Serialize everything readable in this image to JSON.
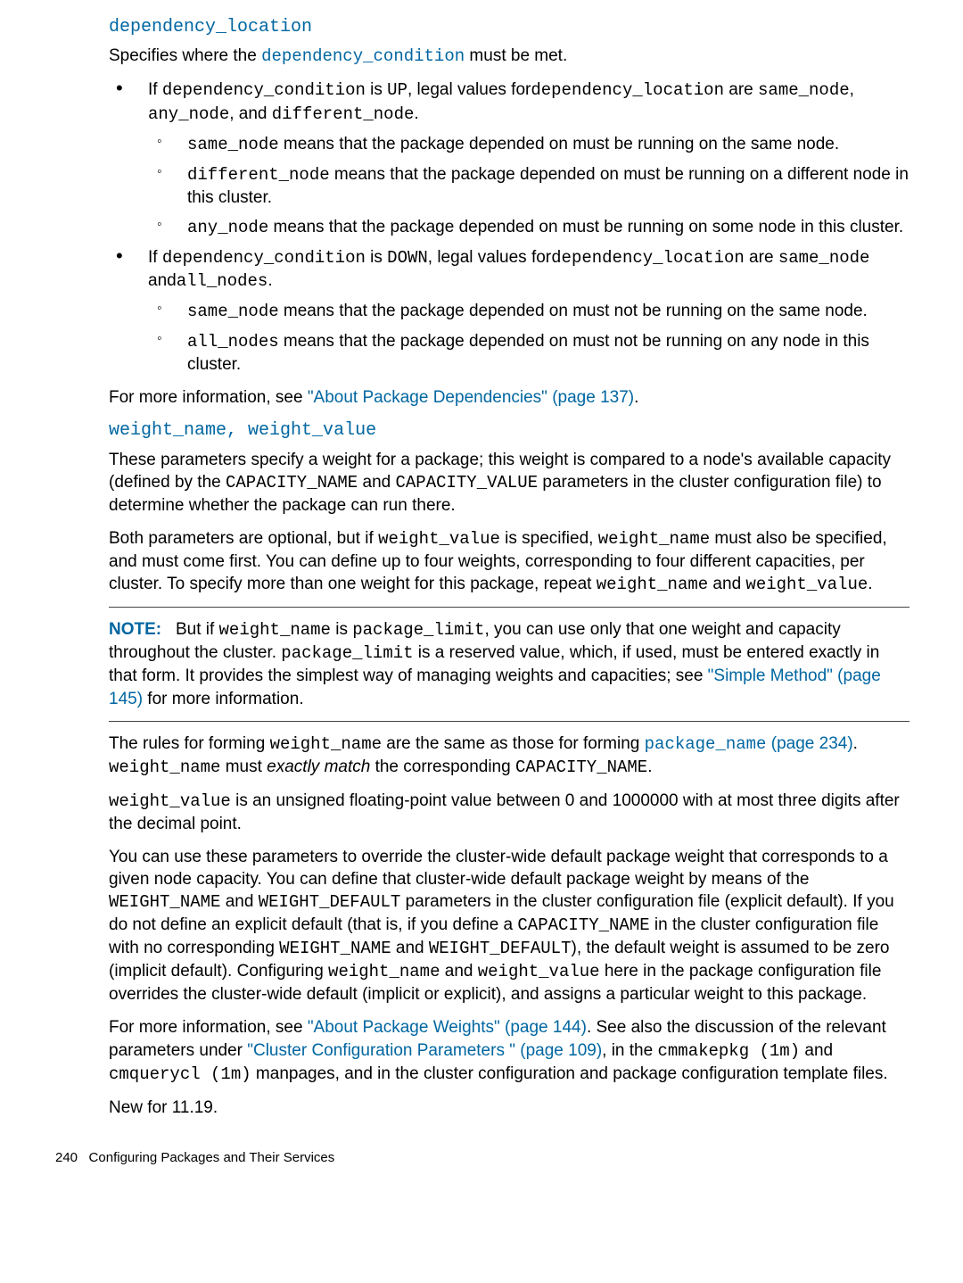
{
  "sec1": {
    "heading": "dependency_location",
    "intro_a": "Specifies where the ",
    "intro_b": "dependency_condition",
    "intro_c": " must be met.",
    "li1_a": "If ",
    "li1_b": "dependency_condition",
    "li1_c": " is ",
    "li1_d": "UP",
    "li1_e": ", legal values for",
    "li1_f": "dependency_location",
    "li1_g": " are ",
    "li1_h": "same_node",
    "li1_i": ", ",
    "li1_j": "any_node",
    "li1_k": ", and ",
    "li1_l": "different_node",
    "li1_m": ".",
    "li1s1_a": "same_node",
    "li1s1_b": " means that the package depended on must be running on the same node.",
    "li1s2_a": "different_node",
    "li1s2_b": " means that the package depended on must be running on a different node in this cluster.",
    "li1s3_a": "any_node",
    "li1s3_b": " means that the package depended on must be running on some node in this cluster.",
    "li2_a": "If ",
    "li2_b": "dependency_condition",
    "li2_c": " is ",
    "li2_d": "DOWN",
    "li2_e": ", legal values for",
    "li2_f": "dependency_location",
    "li2_g": " are ",
    "li2_h": "same_node",
    "li2_i": " and",
    "li2_j": "all_nodes",
    "li2_k": ".",
    "li2s1_a": "same_node",
    "li2s1_b": " means that the package depended on must not be running on the same node.",
    "li2s2_a": "all_nodes",
    "li2s2_b": " means that the package depended on must not be running on any node in this cluster.",
    "more_a": "For more information, see ",
    "more_b": "\"About Package Dependencies\" (page 137)",
    "more_c": "."
  },
  "sec2": {
    "heading_a": "weight_name",
    "heading_sep": ", ",
    "heading_b": "weight_value",
    "p1_a": "These parameters specify a weight for a package; this weight is compared to a node's available capacity (defined by the ",
    "p1_b": "CAPACITY_NAME",
    "p1_c": " and ",
    "p1_d": "CAPACITY_VALUE",
    "p1_e": " parameters in the cluster configuration file) to determine whether the package can run there.",
    "p2_a": "Both parameters are optional, but if ",
    "p2_b": "weight_value",
    "p2_c": " is specified, ",
    "p2_d": "weight_name",
    "p2_e": " must also be specified, and must come first. You can define up to four weights, corresponding to four different capacities, per cluster. To specify more than one weight for this package, repeat ",
    "p2_f": "weight_name",
    "p2_g": " and ",
    "p2_h": "weight_value",
    "p2_i": ".",
    "note_label": "NOTE:",
    "note_a": "But if ",
    "note_b": "weight_name",
    "note_c": " is ",
    "note_d": "package_limit",
    "note_e": ", you can use only that one weight and capacity throughout the cluster. ",
    "note_f": "package_limit",
    "note_g": " is a reserved value, which, if used, must be entered exactly in that form. It provides the simplest way of managing weights and capacities; see ",
    "note_h": "\"Simple Method\" (page 145)",
    "note_i": " for more information.",
    "p3_a": "The rules for forming ",
    "p3_b": "weight_name",
    "p3_c": " are the same as those for forming ",
    "p3_d": "package_name",
    "p3_e": " (page 234)",
    "p3_f": ". ",
    "p3_g": "weight_name",
    "p3_h": " must ",
    "p3_i": "exactly match",
    "p3_j": " the corresponding ",
    "p3_k": "CAPACITY_NAME",
    "p3_l": ".",
    "p4_a": "weight_value",
    "p4_b": " is an unsigned floating-point value between 0 and 1000000 with at most three digits after the decimal point.",
    "p5_a": "You can use these parameters to override the cluster-wide default package weight that corresponds to a given node capacity. You can define that cluster-wide default package weight by means of the ",
    "p5_b": "WEIGHT_NAME",
    "p5_c": " and ",
    "p5_d": "WEIGHT_DEFAULT",
    "p5_e": " parameters in the cluster configuration file (explicit default). If you do not define an explicit default (that is, if you define a ",
    "p5_f": "CAPACITY_NAME",
    "p5_g": " in the cluster configuration file with no corresponding ",
    "p5_h": "WEIGHT_NAME",
    "p5_i": " and ",
    "p5_j": "WEIGHT_DEFAULT",
    "p5_k": "), the default weight is assumed to be zero (implicit default). Configuring ",
    "p5_l": "weight_name",
    "p5_m": " and ",
    "p5_n": "weight_value",
    "p5_o": " here in the package configuration file overrides the cluster-wide default (implicit or explicit), and assigns a particular weight to this package.",
    "p6_a": "For more information, see ",
    "p6_b": "\"About Package Weights\" (page 144)",
    "p6_c": ". See also the discussion of the relevant parameters under ",
    "p6_d": "\"Cluster Configuration Parameters \" (page 109)",
    "p6_e": ", in the ",
    "p6_f": "cmmakepkg (1m)",
    "p6_g": " and ",
    "p6_h": "cmquerycl (1m)",
    "p6_i": " manpages, and in the cluster configuration and package configuration template files.",
    "p7": "New for 11.19."
  },
  "footer": {
    "page_no": "240",
    "title": "Configuring Packages and Their Services"
  }
}
